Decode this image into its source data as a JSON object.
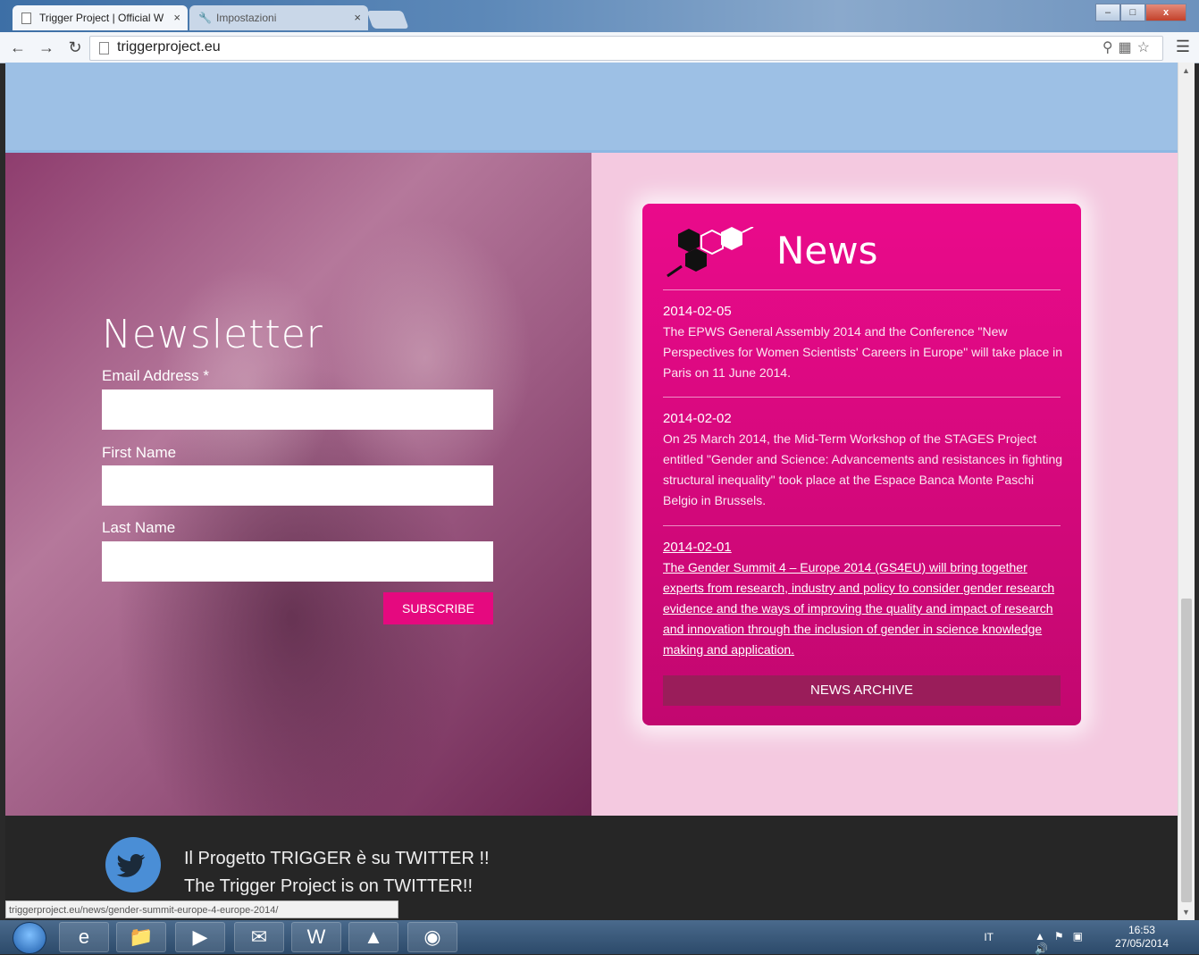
{
  "browser": {
    "tabs": [
      {
        "title": "Trigger Project | Official W",
        "close": "×"
      },
      {
        "title": "Impostazioni",
        "close": "×"
      }
    ],
    "url": "triggerproject.eu",
    "window_buttons": {
      "minimize": "–",
      "maximize": "□",
      "close": "x"
    }
  },
  "newsletter": {
    "title": "Newsletter",
    "email_label": "Email Address *",
    "first_name_label": "First Name",
    "last_name_label": "Last Name",
    "subscribe_label": "SUBSCRIBE"
  },
  "news": {
    "title": "News",
    "items": [
      {
        "date": "2014-02-05",
        "text": "The EPWS General Assembly 2014 and the Conference \"New Perspectives for Women Scientists' Careers in Europe\" will take place in Paris on 11 June 2014.",
        "linked": false
      },
      {
        "date": "2014-02-02",
        "text": "On 25 March 2014, the Mid-Term Workshop of the STAGES Project entitled \"Gender and Science: Advancements and resistances in fighting structural inequality\" took place at the Espace Banca Monte Paschi Belgio in Brussels.",
        "linked": false
      },
      {
        "date": "2014-02-01",
        "text": "The Gender Summit 4 – Europe 2014 (GS4EU) will bring together experts from research, industry and policy to consider gender research evidence and the ways of improving the quality and impact of research and innovation through the inclusion of gender in science knowledge making and application.",
        "linked": true
      }
    ],
    "archive_label": "NEWS ARCHIVE"
  },
  "footer": {
    "twitter_it": "Il Progetto TRIGGER è su TWITTER !!",
    "twitter_en": "The Trigger Project is on TWITTER!!"
  },
  "status_bar": {
    "url": "triggerproject.eu/news/gender-summit-europe-4-europe-2014/"
  },
  "taskbar": {
    "language": "IT",
    "time": "16:53",
    "date": "27/05/2014",
    "apps": [
      "internet-explorer",
      "file-explorer",
      "media-player",
      "outlook",
      "word",
      "acrobat",
      "chrome"
    ]
  },
  "colors": {
    "accent_pink": "#e5097f",
    "news_box": "#ea0a8b",
    "news_archive_bg": "#9a1d5a",
    "header_band": "#9dc0e5",
    "footer_bg": "#262626",
    "twitter_blue": "#4a8ed6"
  }
}
